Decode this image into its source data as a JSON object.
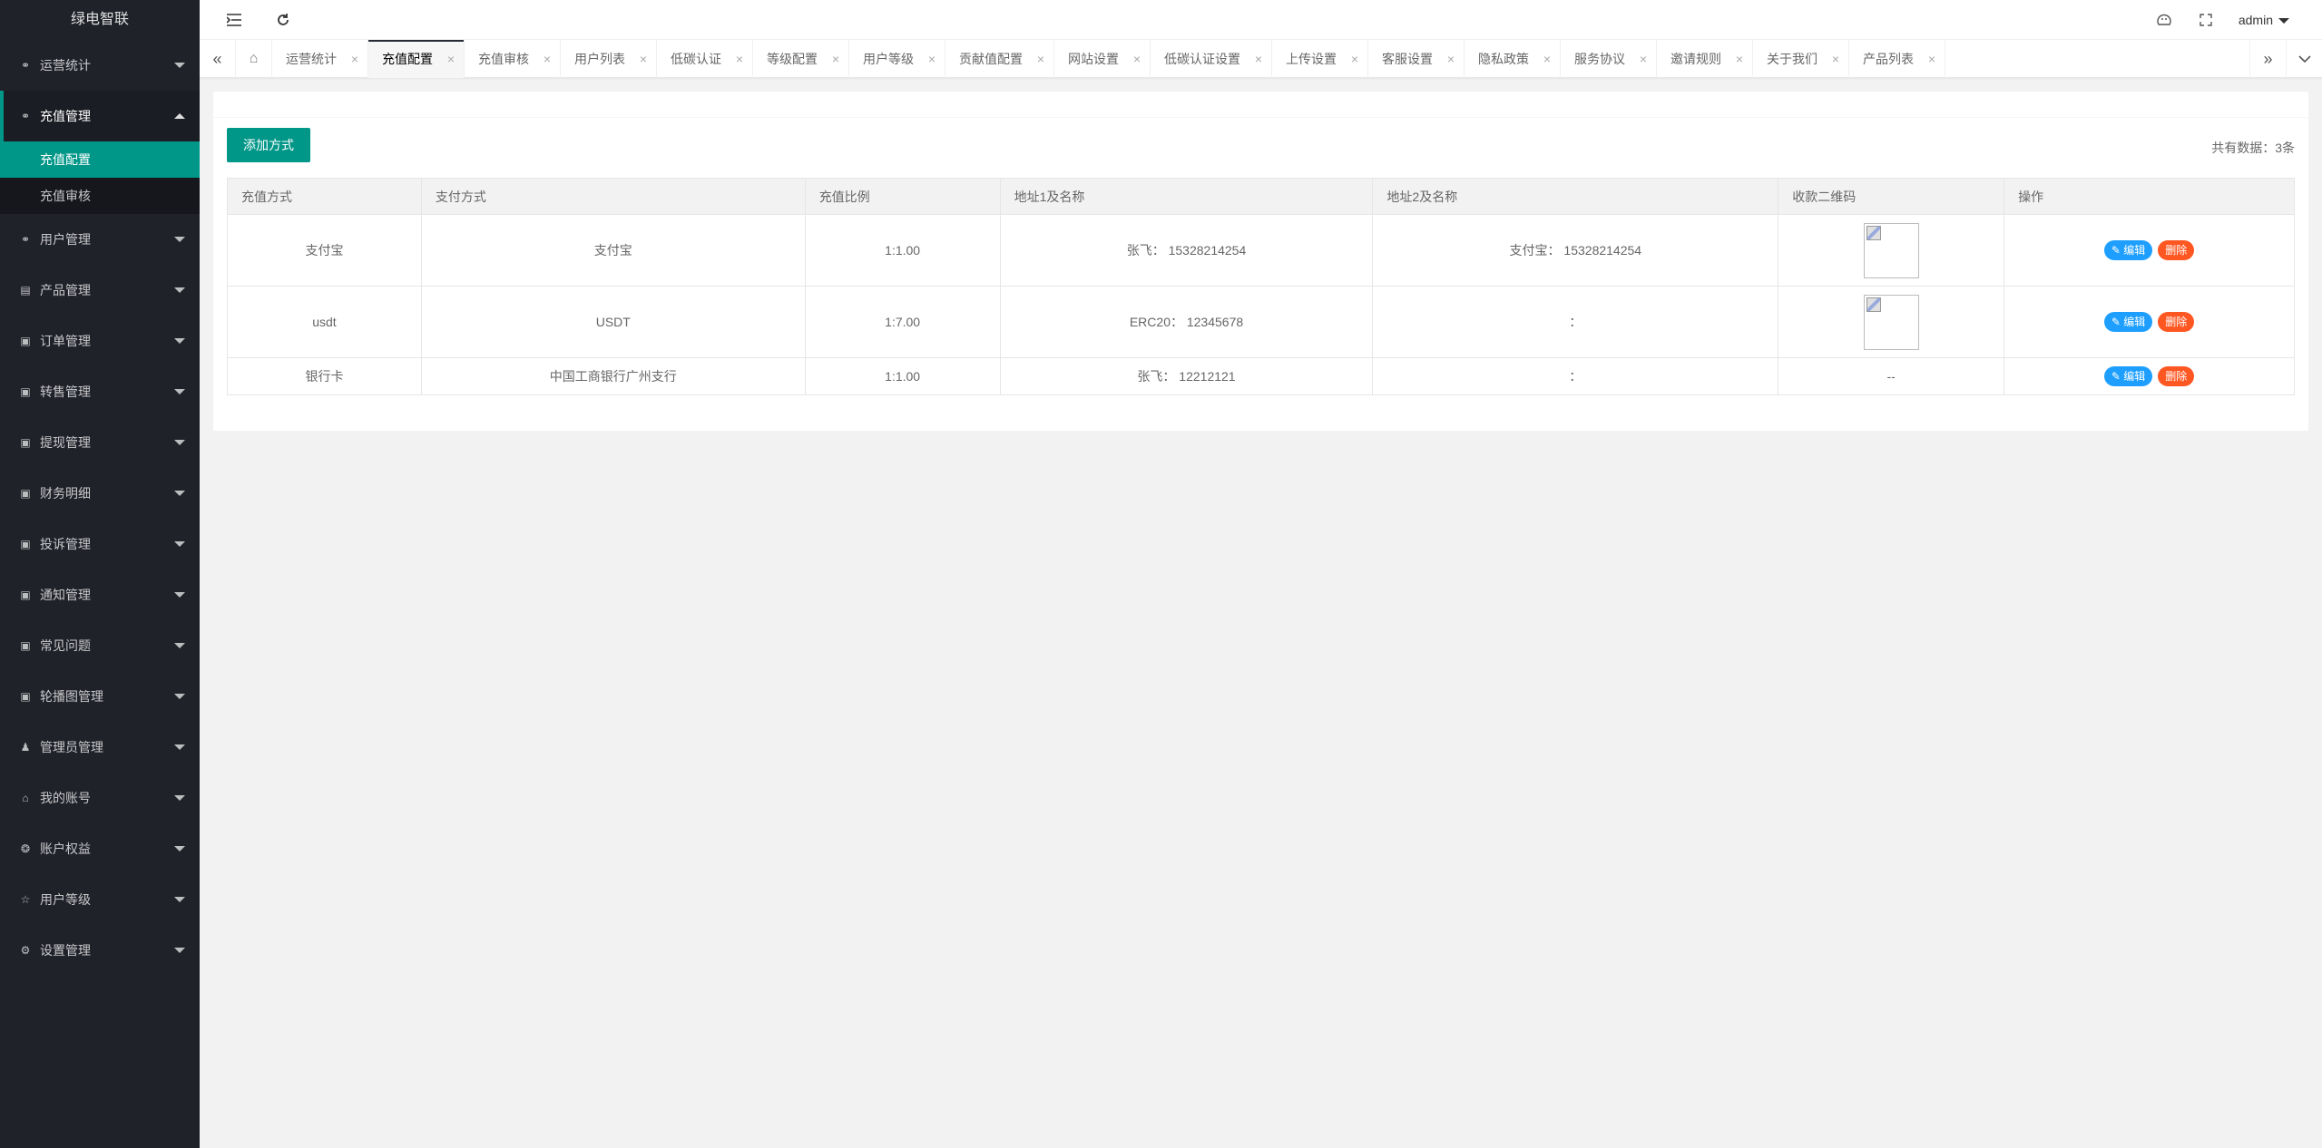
{
  "app": {
    "title": "绿电智联"
  },
  "sidebar": {
    "items": [
      {
        "label": "运营统计",
        "icon": "user-icon"
      },
      {
        "label": "充值管理",
        "icon": "user-icon",
        "open": true
      },
      {
        "label": "用户管理",
        "icon": "user-icon"
      },
      {
        "label": "产品管理",
        "icon": "file-icon"
      },
      {
        "label": "订单管理",
        "icon": "picture-icon"
      },
      {
        "label": "转售管理",
        "icon": "picture-icon"
      },
      {
        "label": "提现管理",
        "icon": "picture-icon"
      },
      {
        "label": "财务明细",
        "icon": "picture-icon"
      },
      {
        "label": "投诉管理",
        "icon": "picture-icon"
      },
      {
        "label": "通知管理",
        "icon": "picture-icon"
      },
      {
        "label": "常见问题",
        "icon": "picture-icon"
      },
      {
        "label": "轮播图管理",
        "icon": "picture-icon"
      },
      {
        "label": "管理员管理",
        "icon": "person-icon"
      },
      {
        "label": "我的账号",
        "icon": "home-icon"
      },
      {
        "label": "账户权益",
        "icon": "gear-circle-icon"
      },
      {
        "label": "用户等级",
        "icon": "star-icon"
      },
      {
        "label": "设置管理",
        "icon": "gear-icon"
      }
    ],
    "submenu": [
      {
        "label": "充值配置",
        "active": true
      },
      {
        "label": "充值审核"
      }
    ]
  },
  "header": {
    "user": "admin"
  },
  "tabs": [
    {
      "label": "运营统计"
    },
    {
      "label": "充值配置",
      "active": true
    },
    {
      "label": "充值审核"
    },
    {
      "label": "用户列表"
    },
    {
      "label": "低碳认证"
    },
    {
      "label": "等级配置"
    },
    {
      "label": "用户等级"
    },
    {
      "label": "贡献值配置"
    },
    {
      "label": "网站设置"
    },
    {
      "label": "低碳认证设置"
    },
    {
      "label": "上传设置"
    },
    {
      "label": "客服设置"
    },
    {
      "label": "隐私政策"
    },
    {
      "label": "服务协议"
    },
    {
      "label": "邀请规则"
    },
    {
      "label": "关于我们"
    },
    {
      "label": "产品列表"
    }
  ],
  "toolbar": {
    "add_label": "添加方式",
    "total_label": "共有数据：",
    "total_count": "3条"
  },
  "table": {
    "columns": [
      "充值方式",
      "支付方式",
      "充值比例",
      "地址1及名称",
      "地址2及名称",
      "收款二维码",
      "操作"
    ],
    "rows": [
      {
        "method": "支付宝",
        "pay": "支付宝",
        "ratio": "1:1.00",
        "addr1": "张飞： 15328214254",
        "addr2": "支付宝： 15328214254",
        "qr": true
      },
      {
        "method": "usdt",
        "pay": "USDT",
        "ratio": "1:7.00",
        "addr1": "ERC20： 12345678",
        "addr2": "：",
        "qr": true
      },
      {
        "method": "银行卡",
        "pay": "中国工商银行广州支行",
        "ratio": "1:1.00",
        "addr1": "张飞： 12212121",
        "addr2": "：",
        "qr": false,
        "qr_text": "--"
      }
    ],
    "edit_label": "编辑",
    "delete_label": "删除"
  }
}
